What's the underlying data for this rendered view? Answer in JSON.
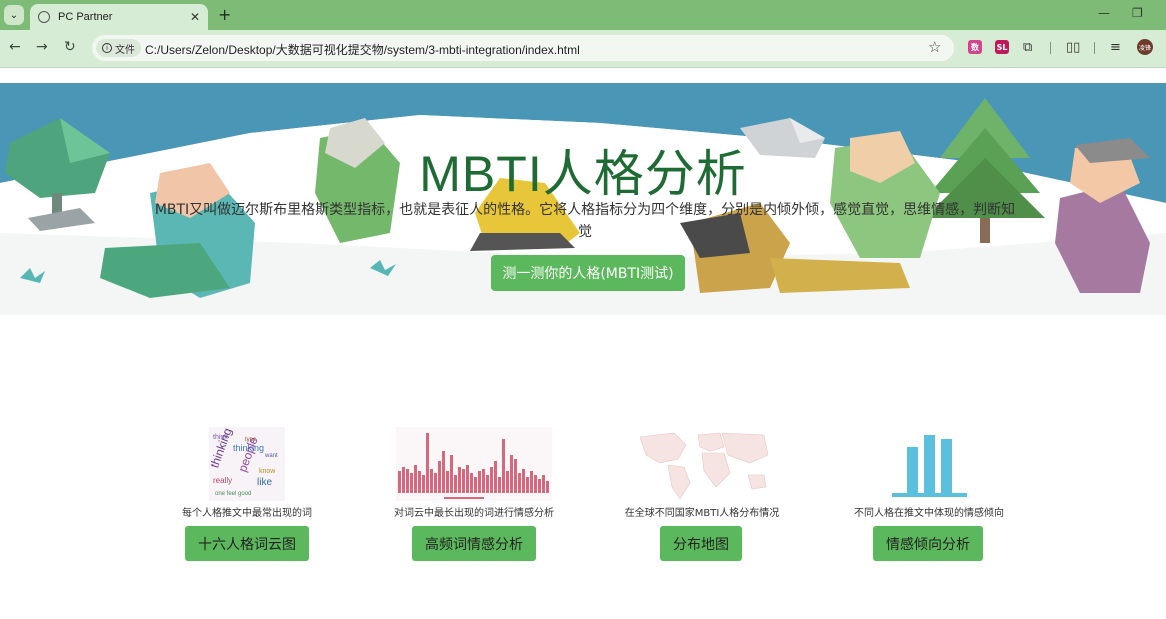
{
  "browser": {
    "tab_title": "PC Partner",
    "secure_label": "文件",
    "url": "C:/Users/Zelon/Desktop/大数据可视化提交物/system/3-mbti-integration/index.html",
    "ext1": "数",
    "ext2": "SL",
    "avatar": "凌锋"
  },
  "hero": {
    "title": "MBTI人格分析",
    "description": "MBTI又叫做迈尔斯布里格斯类型指标，也就是表征人的性格。它将人格指标分为四个维度，分别是内倾外倾，感觉直觉，思维情感，判断知觉",
    "cta": "测一测你的人格(MBTI测试)"
  },
  "features": [
    {
      "caption": "每个人格推文中最常出现的词",
      "button": "十六人格词云图",
      "thumb": "word-cloud"
    },
    {
      "caption": "对词云中最长出现的词进行情感分析",
      "button": "高频词情感分析",
      "thumb": "bar-chart"
    },
    {
      "caption": "在全球不同国家MBTI人格分布情况",
      "button": "分布地图",
      "thumb": "world-map"
    },
    {
      "caption": "不同人格在推文中体现的情感倾向",
      "button": "情感倾向分析",
      "thumb": "bar-chart-icon"
    }
  ],
  "colors": {
    "brand_green": "#5cb85c",
    "title_green": "#1f6b34",
    "sky": "#4a96b6"
  }
}
